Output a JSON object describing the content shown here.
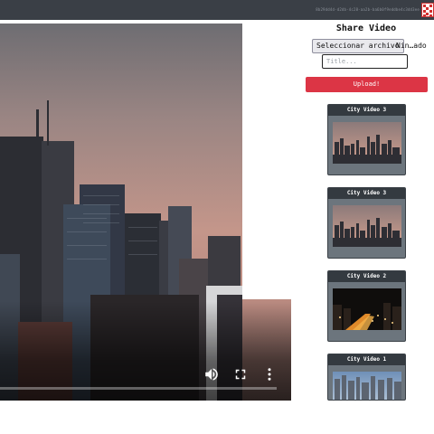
{
  "header": {
    "user_text": "8b29dd4d-d2db-4c28-aa2b-ba6b0f9eddbe4c3dd3ee",
    "avatar_icon": "identicon-avatar",
    "bg_color": "#3a3f46"
  },
  "player": {
    "volume_icon": "volume-icon",
    "fullscreen_icon": "fullscreen-icon",
    "menu_icon": "more-vert-icon",
    "progress": 0
  },
  "upload": {
    "title": "Share Video",
    "file_button_label": "Seleccionar archivo",
    "file_status": "Nin…ado",
    "title_placeholder": "Title...",
    "upload_label": "Upload!",
    "upload_color": "#dc3545"
  },
  "videos": [
    {
      "title": "City Video 3",
      "thumb": "dusk-skyline"
    },
    {
      "title": "City Video 3",
      "thumb": "dusk-skyline"
    },
    {
      "title": "City Video 2",
      "thumb": "night-highway"
    },
    {
      "title": "City Video 1",
      "thumb": "day-city"
    }
  ]
}
